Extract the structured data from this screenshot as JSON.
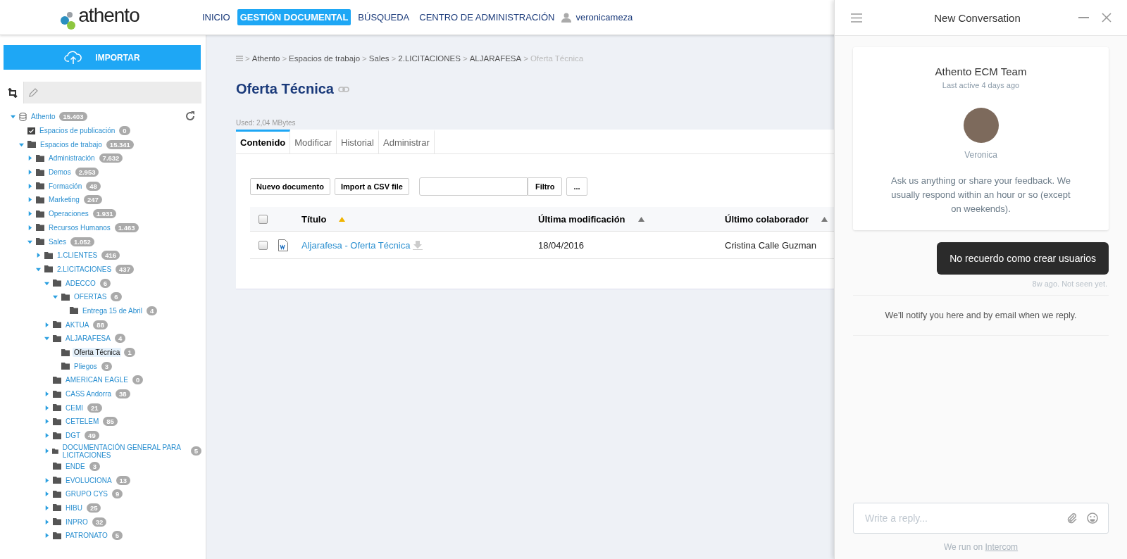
{
  "header": {
    "logo": "athento",
    "nav": [
      {
        "label": "INICIO",
        "selected": false
      },
      {
        "label": "GESTIÓN DOCUMENTAL",
        "selected": true
      },
      {
        "label": "BÚSQUEDA",
        "selected": false
      },
      {
        "label": "CENTRO DE ADMINISTRACIÓN",
        "selected": false
      }
    ],
    "user": "veronicameza"
  },
  "sidebar": {
    "import_button": "IMPORTAR",
    "tree": [
      {
        "label": "Athento",
        "count": "15.403",
        "expanded": true,
        "selected": false,
        "children": [
          {
            "label": "Espacios de publicación",
            "count": "0",
            "selected": false
          },
          {
            "label": "Espacios de trabajo",
            "count": "15.341",
            "expanded": true,
            "selected": false,
            "children": [
              {
                "label": "Administración",
                "count": "7.632",
                "expanded": false,
                "selected": false
              },
              {
                "label": "Demos",
                "count": "2.953",
                "expanded": false,
                "selected": false
              },
              {
                "label": "Formación",
                "count": "48",
                "expanded": false,
                "selected": false
              },
              {
                "label": "Marketing",
                "count": "247",
                "expanded": false,
                "selected": false
              },
              {
                "label": "Operaciones",
                "count": "1.931",
                "expanded": false,
                "selected": false
              },
              {
                "label": "Recursos Humanos",
                "count": "1.463",
                "expanded": false,
                "selected": false
              },
              {
                "label": "Sales",
                "count": "1.052",
                "expanded": true,
                "selected": false,
                "children": [
                  {
                    "label": "1.CLIENTES",
                    "count": "416",
                    "expanded": false,
                    "selected": false
                  },
                  {
                    "label": "2.LICITACIONES",
                    "count": "437",
                    "expanded": true,
                    "selected": false,
                    "children": [
                      {
                        "label": "ADECCO",
                        "count": "6",
                        "expanded": true,
                        "selected": false,
                        "children": [
                          {
                            "label": "OFERTAS",
                            "count": "6",
                            "expanded": true,
                            "selected": false,
                            "children": [
                              {
                                "label": "Entrega 15 de Abril",
                                "count": "4",
                                "selected": false
                              }
                            ]
                          }
                        ]
                      },
                      {
                        "label": "AKTUA",
                        "count": "88",
                        "expanded": false,
                        "selected": false
                      },
                      {
                        "label": "ALJARAFESA",
                        "count": "4",
                        "expanded": true,
                        "selected": false,
                        "children": [
                          {
                            "label": "Oferta Técnica",
                            "count": "1",
                            "selected": true
                          },
                          {
                            "label": "Pliegos",
                            "count": "3",
                            "selected": false
                          }
                        ]
                      },
                      {
                        "label": "AMERICAN EAGLE",
                        "count": "0",
                        "selected": false
                      },
                      {
                        "label": "CASS Andorra",
                        "count": "38",
                        "expanded": false,
                        "selected": false
                      },
                      {
                        "label": "CEMI",
                        "count": "21",
                        "expanded": false,
                        "selected": false
                      },
                      {
                        "label": "CETELEM",
                        "count": "85",
                        "expanded": false,
                        "selected": false
                      },
                      {
                        "label": "DGT",
                        "count": "49",
                        "expanded": false,
                        "selected": false
                      },
                      {
                        "label": "DOCUMENTACIÓN GENERAL PARA LICITACIONES",
                        "count": "5",
                        "expanded": false,
                        "selected": false
                      },
                      {
                        "label": "ENDE",
                        "count": "3",
                        "selected": false
                      },
                      {
                        "label": "EVOLUCIONA",
                        "count": "13",
                        "expanded": false,
                        "selected": false
                      },
                      {
                        "label": "GRUPO CYS",
                        "count": "9",
                        "expanded": false,
                        "selected": false
                      },
                      {
                        "label": "HIBU",
                        "count": "25",
                        "expanded": false,
                        "selected": false
                      },
                      {
                        "label": "INPRO",
                        "count": "32",
                        "expanded": false,
                        "selected": false
                      },
                      {
                        "label": "PATRONATO",
                        "count": "5",
                        "expanded": false,
                        "selected": false
                      }
                    ]
                  }
                ]
              }
            ]
          }
        ]
      }
    ]
  },
  "breadcrumb": {
    "separator": ">",
    "items": [
      "Athento",
      "Espacios de trabajo",
      "Sales",
      "2.LICITACIONES",
      "ALJARAFESA",
      "Oferta Técnica"
    ]
  },
  "document": {
    "title": "Oferta Técnica",
    "used": "Used: 2,04 MBytes",
    "tabs": [
      {
        "label": "Contenido",
        "selected": true
      },
      {
        "label": "Modificar",
        "selected": false
      },
      {
        "label": "Historial",
        "selected": false
      },
      {
        "label": "Administrar",
        "selected": false
      }
    ],
    "buttons": [
      "Nuevo documento",
      "Import a CSV file"
    ],
    "filter_button": "Filtro",
    "more_button": "...",
    "table": {
      "header_checked": false,
      "columns": [
        {
          "label": "Título",
          "sort_active": true
        },
        {
          "label": "Última modificación",
          "sort_active": false
        },
        {
          "label": "Último colaborador",
          "sort_active": false
        }
      ],
      "rows": [
        {
          "checked": false,
          "title": "Aljarafesa - Oferta Técnica",
          "modified": "18/04/2016",
          "collaborator": "Cristina Calle Guzman"
        }
      ]
    }
  },
  "chat": {
    "title": "New Conversation",
    "team": "Athento ECM Team",
    "last_active": "Last active 4 days ago",
    "agent": "Veronica",
    "intro": "Ask us anything or share your feedback. We usually respond within an hour or so (except on weekends).",
    "message": "No recuerdo como crear usuarios",
    "message_status": "8w ago. Not seen yet.",
    "notice": "We'll notify you here and by email when we reply.",
    "reply_placeholder": "Write a reply...",
    "footer": "We run on",
    "footer_link": "Intercom"
  }
}
